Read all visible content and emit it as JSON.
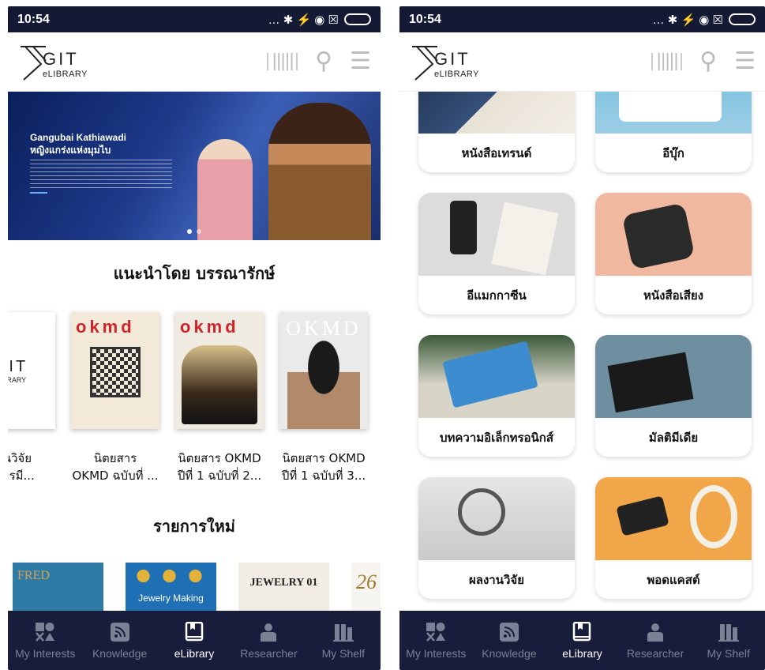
{
  "status": {
    "time": "10:54",
    "icons": "… ✱ ⚡ ◉ ☒"
  },
  "logo": {
    "name": "GIT",
    "sub": "eLIBRARY"
  },
  "banner": {
    "title_line1": "Gangubai Kathiawadi",
    "title_line2": "หญิงแกร่งแห่งมุมไบ"
  },
  "left": {
    "recommended_title": "แนะนำโดย บรรณารักษ์",
    "books": [
      {
        "title1": "งานวิจัย",
        "title2": "มการมี...",
        "cover_name": "GIT",
        "cover_sub": "LIBRARY"
      },
      {
        "title1": "นิตยสาร",
        "title2": "OKMD ฉบับที่ ...",
        "cover_name": "okmd"
      },
      {
        "title1": "นิตยสาร OKMD",
        "title2": "ปีที่ 1 ฉบับที่ 2...",
        "cover_name": "okmd"
      },
      {
        "title1": "นิตยสาร OKMD",
        "title2": "ปีที่ 1 ฉบับที่ 3...",
        "cover_name": "OKMD"
      }
    ],
    "new_title": "รายการใหม่",
    "new_items": [
      "FRED",
      "Jewelry Making",
      "JEWELRY 01",
      "26"
    ]
  },
  "right": {
    "categories": [
      "หนังสือเทรนด์",
      "อีบุ๊ก",
      "อีแมกกาซีน",
      "หนังสือเสียง",
      "บทความอิเล็กทรอนิกส์",
      "มัลติมีเดีย",
      "ผลงานวิจัย",
      "พอดแคสต์"
    ]
  },
  "tabs": [
    "My Interests",
    "Knowledge",
    "eLibrary",
    "Researcher",
    "My Shelf"
  ],
  "colors": {
    "statusbar": "#141a33",
    "tabbar": "#171d3a",
    "accent": "#ffffff",
    "inactive": "#7b8194"
  }
}
